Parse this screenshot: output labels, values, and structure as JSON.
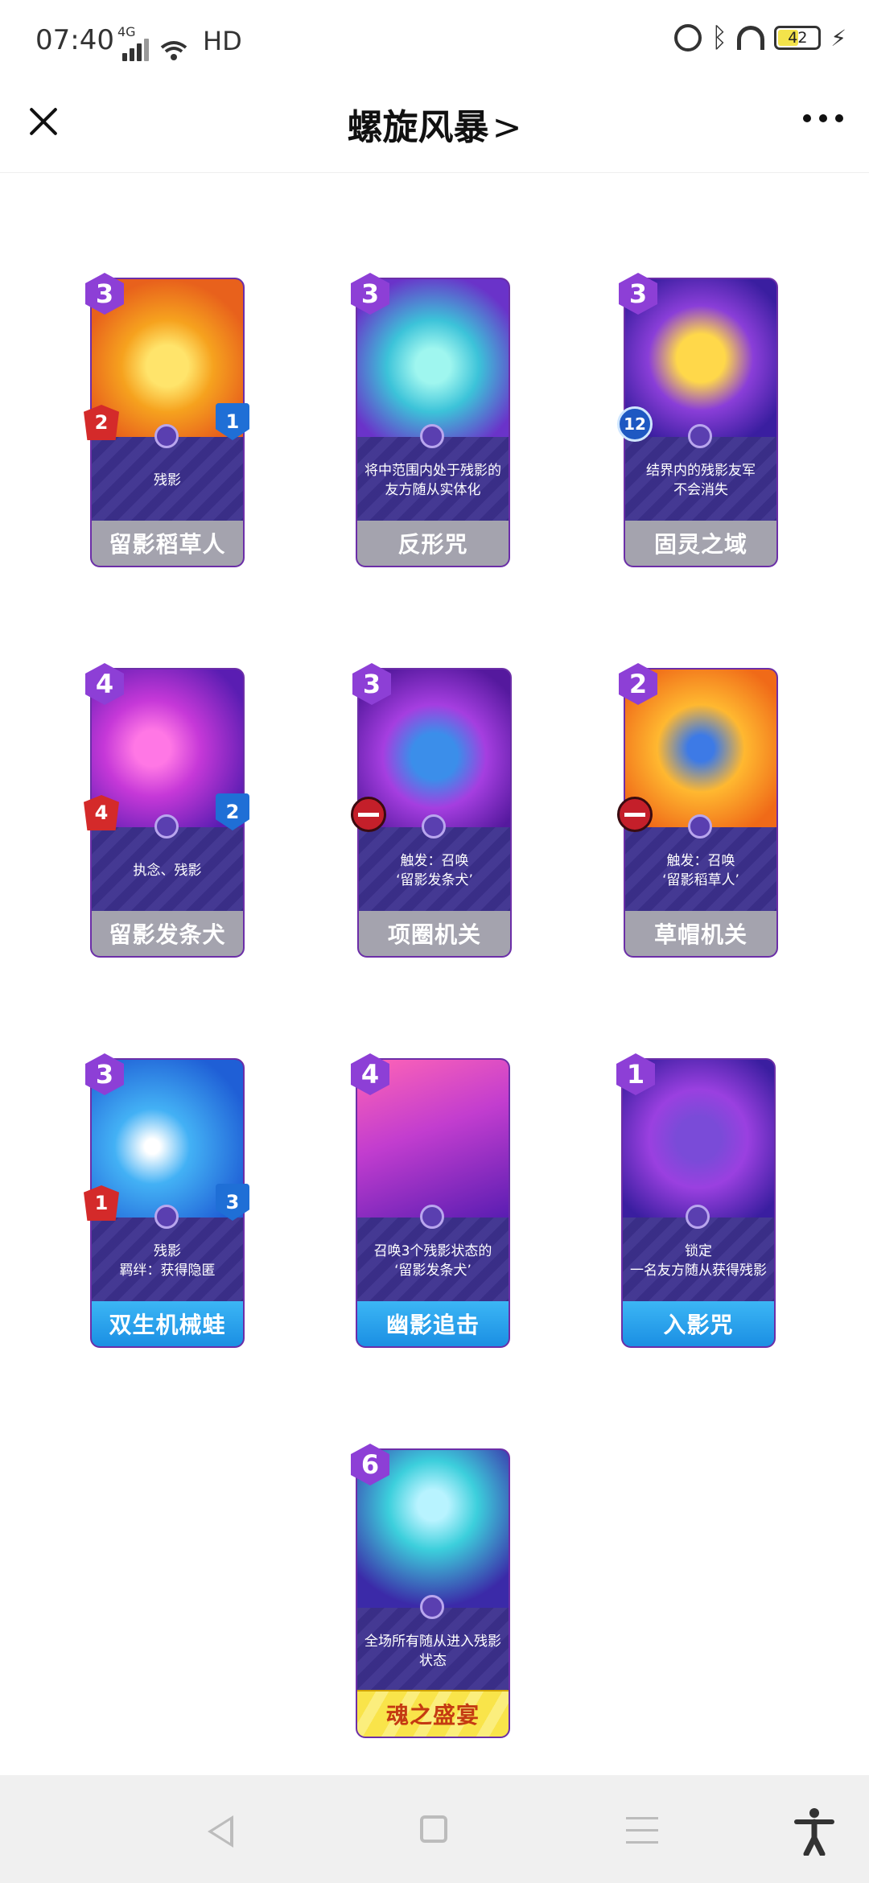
{
  "status_bar": {
    "time": "07:40",
    "network": "4G",
    "hd": "HD",
    "battery": "42"
  },
  "header": {
    "title": "螺旋风暴",
    "chevron": ">"
  },
  "cards": [
    {
      "cost": "3",
      "attack": "2",
      "health": "1",
      "desc": "残影",
      "name": "留影稻草人",
      "style": "gray"
    },
    {
      "cost": "3",
      "desc": "将中范围内处于残影的\n友方随从实体化",
      "name": "反形咒",
      "style": "gray"
    },
    {
      "cost": "3",
      "timer": "12",
      "desc": "结界内的残影友军\n不会消失",
      "name": "固灵之域",
      "style": "gray"
    },
    {
      "cost": "4",
      "attack": "4",
      "health": "2",
      "desc": "执念、残影",
      "name": "留影发条犬",
      "style": "gray"
    },
    {
      "cost": "3",
      "desc": "触发：召唤\n‘留影发条犬’",
      "name": "项圈机关",
      "style": "gray"
    },
    {
      "cost": "2",
      "desc": "触发：召唤\n‘留影稻草人’",
      "name": "草帽机关",
      "style": "gray"
    },
    {
      "cost": "3",
      "attack": "1",
      "health": "3",
      "desc": "残影\n羁绊：获得隐匿",
      "name": "双生机械蛙",
      "style": "blue"
    },
    {
      "cost": "4",
      "desc": "召唤3个残影状态的\n‘留影发条犬’",
      "name": "幽影追击",
      "style": "blue"
    },
    {
      "cost": "1",
      "desc": "锁定\n一名友方随从获得残影",
      "name": "入影咒",
      "style": "blue"
    },
    {
      "cost": "6",
      "desc": "全场所有随从进入残影\n状态",
      "name": "魂之盛宴",
      "style": "gold"
    }
  ],
  "colors": {
    "desc_bg": "#3d318f",
    "cost_badge": "#8d3fd6",
    "name_gray": "#a4a3ae",
    "name_blue": "#1b8fe3",
    "name_gold": "#f9e44a"
  },
  "icons": [
    "close-icon",
    "more-icon",
    "back-icon",
    "home-icon",
    "menu-icon",
    "accessibility-icon"
  ]
}
